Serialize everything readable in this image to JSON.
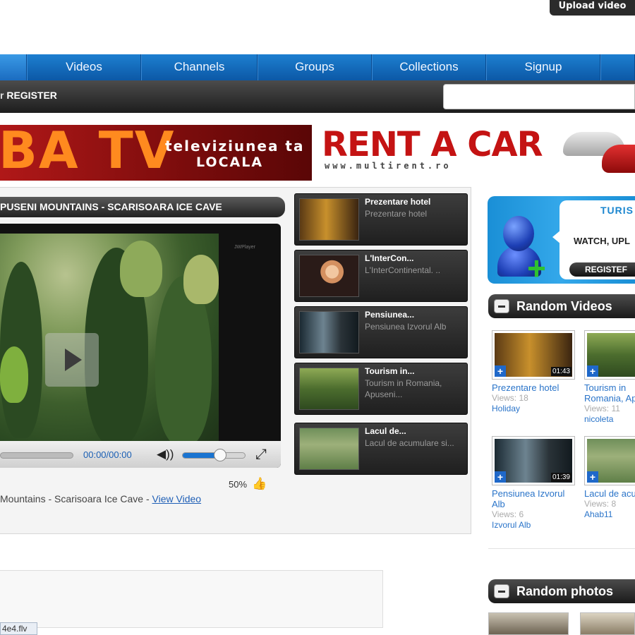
{
  "header": {
    "upload_label": "Upload video"
  },
  "nav": {
    "items": [
      "Videos",
      "Channels",
      "Groups",
      "Collections",
      "Signup"
    ]
  },
  "loginbar": {
    "prefix": "r ",
    "register_label": "REGISTER",
    "search_placeholder": ""
  },
  "banners": {
    "tv_big": "BA TV",
    "tv_line1": "televiziunea ta",
    "tv_line2": "LOCALA",
    "car_title": "RENT A CAR",
    "car_url": "www.multirent.ro"
  },
  "video": {
    "title": "PUSENI MOUNTAINS - SCARISOARA ICE CAVE",
    "player_logo": "JWPlayer",
    "timecode": "00:00/00:00",
    "volume_level": 0.6,
    "rating": "50%",
    "caption": "Mountains - Scarisoara Ice Cave - ",
    "view_link": "View Video"
  },
  "related": [
    {
      "title": "Prezentare hotel",
      "desc": "Prezentare hotel"
    },
    {
      "title": "L'InterCon...",
      "desc": "L'InterContinental. .."
    },
    {
      "title": "Pensiunea...",
      "desc": "Pensiunea Izvorul Alb"
    },
    {
      "title": "Tourism in...",
      "desc": "Tourism in Romania, Apuseni..."
    },
    {
      "title": "Lacul de...",
      "desc": "Lacul de acumulare si..."
    }
  ],
  "promo": {
    "tur": "TURIS",
    "watch": "WATCH, UPL",
    "register": "REGISTEF"
  },
  "random_videos": {
    "heading": "Random Videos",
    "items": [
      {
        "title": "Prezentare hotel",
        "views": "Views: 18",
        "user": "Holiday",
        "duration": "01:43"
      },
      {
        "title": "Tourism in Romania, Apuseni...",
        "views": "Views: 11",
        "user": "nicoleta",
        "duration": ""
      },
      {
        "title": "Pensiunea Izvorul Alb",
        "views": "Views: 6",
        "user": "Izvorul Alb",
        "duration": "01:39"
      },
      {
        "title": "Lacul de acumulare",
        "views": "Views: 8",
        "user": "Ahab11",
        "duration": ""
      }
    ]
  },
  "random_photos": {
    "heading": "Random photos"
  },
  "status": {
    "text": "4e4.flv"
  }
}
